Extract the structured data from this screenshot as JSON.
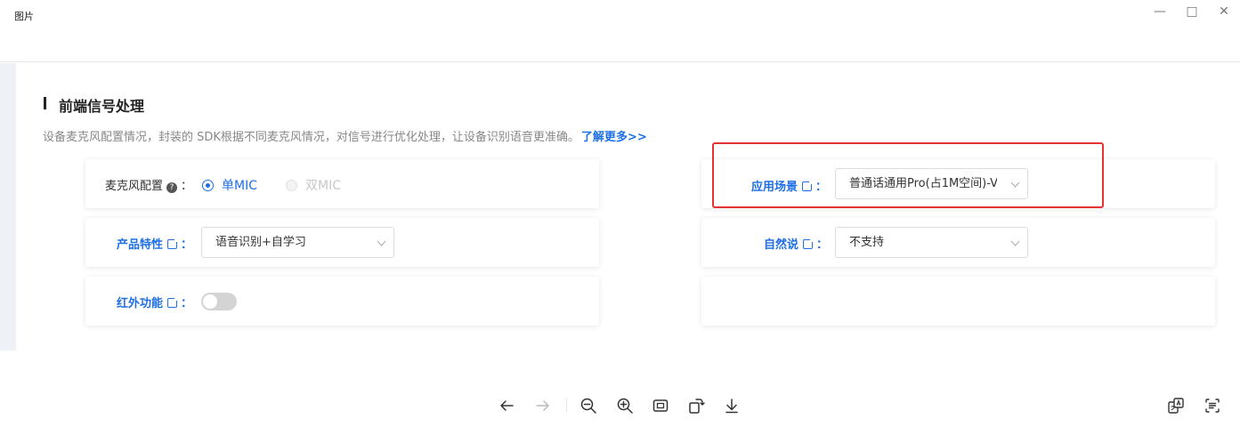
{
  "window": {
    "title": "图片",
    "minimize_icon": "minimize-icon",
    "maximize_icon": "maximize-icon",
    "close_icon": "close-icon"
  },
  "section": {
    "title": "前端信号处理",
    "description": "设备麦克风配置情况，封装的 SDK根据不同麦克风情况，对信号进行优化处理，让设备识别语音更准确。",
    "more_link": "了解更多>>"
  },
  "settings": {
    "mic_config": {
      "label": "麦克风配置",
      "colon": "：",
      "options": [
        {
          "label": "单MIC",
          "selected": true
        },
        {
          "label": "双MIC",
          "selected": false,
          "disabled": true
        }
      ]
    },
    "product_feature": {
      "label": "产品特性",
      "colon": "：",
      "value": "语音识别+自学习"
    },
    "infrared": {
      "label": "红外功能",
      "colon": "：",
      "enabled": false
    },
    "scenario": {
      "label": "应用场景",
      "colon": "：",
      "value": "普通话通用Pro(占1M空间)-V"
    },
    "natural_speech": {
      "label": "自然说",
      "colon": "：",
      "value": "不支持"
    }
  },
  "colors": {
    "accent": "#1e6fe6",
    "highlight_border": "#e53333"
  },
  "toolbar": {
    "icons": [
      "arrow-left-icon",
      "arrow-right-icon",
      "zoom-out-icon",
      "zoom-in-icon",
      "fit-window-icon",
      "rotate-icon",
      "download-icon",
      "translate-icon",
      "extract-text-icon"
    ]
  }
}
